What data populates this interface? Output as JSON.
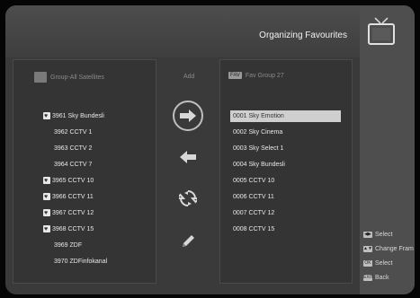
{
  "header": {
    "title": "Organizing Favourites"
  },
  "left_panel": {
    "title": "Group-All Satellites",
    "items": [
      {
        "label": "3961 Sky Bundesli",
        "fav": true
      },
      {
        "label": "3962 CCTV 1",
        "fav": false
      },
      {
        "label": "3963 CCTV 2",
        "fav": false
      },
      {
        "label": "3964 CCTV 7",
        "fav": false
      },
      {
        "label": "3965 CCTV 10",
        "fav": true
      },
      {
        "label": "3966 CCTV 11",
        "fav": true
      },
      {
        "label": "3967 CCTV 12",
        "fav": true
      },
      {
        "label": "3968 CCTV 15",
        "fav": true
      },
      {
        "label": "3969 ZDF",
        "fav": false
      },
      {
        "label": "3970 ZDFinfokanal",
        "fav": false
      }
    ]
  },
  "middle": {
    "add_label": "Add",
    "actions": [
      {
        "icon": "arrow-right-icon"
      },
      {
        "icon": "arrow-left-icon"
      },
      {
        "icon": "swap-icon"
      },
      {
        "icon": "pencil-icon"
      }
    ]
  },
  "right_panel": {
    "badge": "FAV",
    "title": "Fav Group 27",
    "items": [
      "0001 Sky Emotion",
      "0002 Sky Cinema",
      "0003 Sky Select 1",
      "0004 Sky Bundesli",
      "0005 CCTV 10",
      "0006 CCTV 11",
      "0007 CCTV 12",
      "0008 CCTV 15"
    ]
  },
  "legend": [
    {
      "key": "◀▶",
      "label": "Select"
    },
    {
      "key": "▲▼",
      "label": "Change Fram"
    },
    {
      "key": "OK",
      "label": "Select"
    },
    {
      "key": "EXIT",
      "label": "Back"
    }
  ],
  "colors": {
    "background": "#3a3a3a",
    "selection": "#cfcfcf"
  }
}
